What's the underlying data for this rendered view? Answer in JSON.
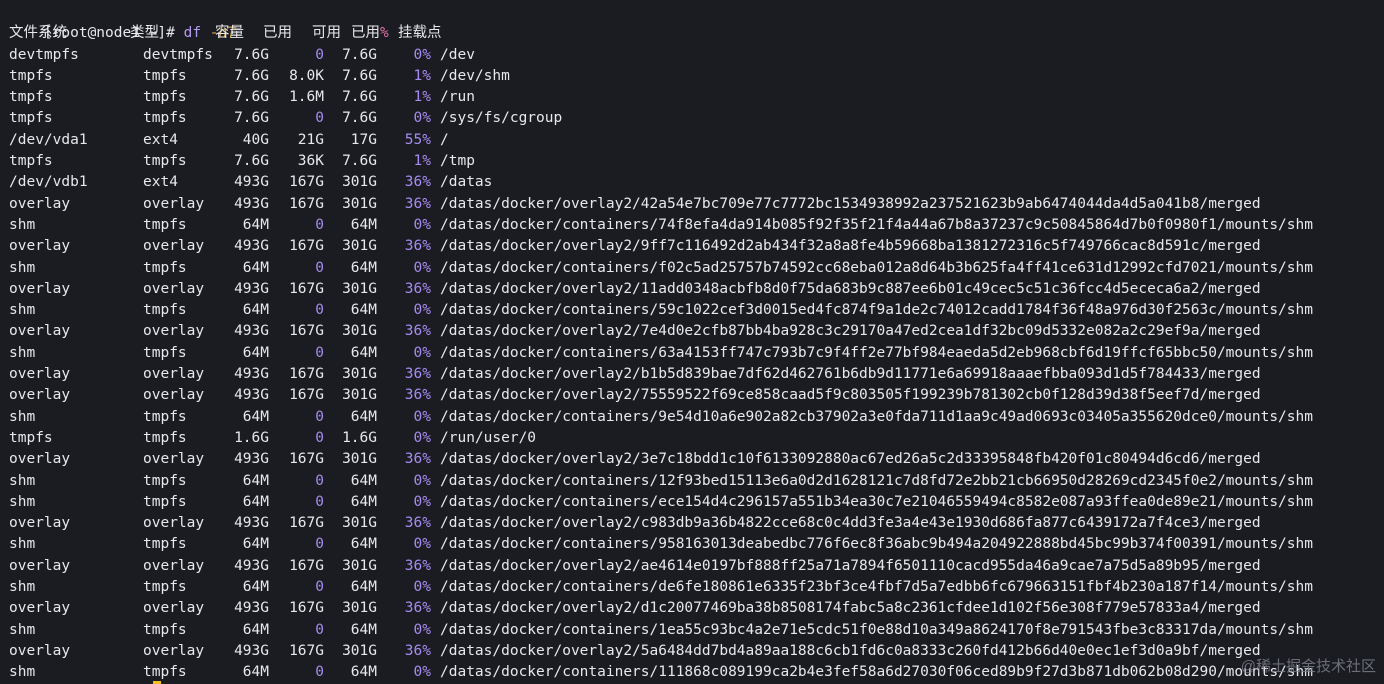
{
  "prompt": {
    "user_host": "[root@node1 ~]#",
    "command": "df",
    "flag": "-hT"
  },
  "header": {
    "filesystem": "文件系统",
    "type": "类型",
    "size": "容量",
    "used": "已用",
    "avail": "可用",
    "pct_label": "已用",
    "pct_sign": "%",
    "mount": "挂载点"
  },
  "rows": [
    {
      "fs": "devtmpfs",
      "type": "devtmpfs",
      "size": "7.6G",
      "used": "0",
      "avail": "7.6G",
      "pct": "0%",
      "mount": "/dev"
    },
    {
      "fs": "tmpfs",
      "type": "tmpfs",
      "size": "7.6G",
      "used": "8.0K",
      "avail": "7.6G",
      "pct": "1%",
      "mount": "/dev/shm"
    },
    {
      "fs": "tmpfs",
      "type": "tmpfs",
      "size": "7.6G",
      "used": "1.6M",
      "avail": "7.6G",
      "pct": "1%",
      "mount": "/run"
    },
    {
      "fs": "tmpfs",
      "type": "tmpfs",
      "size": "7.6G",
      "used": "0",
      "avail": "7.6G",
      "pct": "0%",
      "mount": "/sys/fs/cgroup"
    },
    {
      "fs": "/dev/vda1",
      "type": "ext4",
      "size": "40G",
      "used": "21G",
      "avail": "17G",
      "pct": "55%",
      "mount": "/"
    },
    {
      "fs": "tmpfs",
      "type": "tmpfs",
      "size": "7.6G",
      "used": "36K",
      "avail": "7.6G",
      "pct": "1%",
      "mount": "/tmp"
    },
    {
      "fs": "/dev/vdb1",
      "type": "ext4",
      "size": "493G",
      "used": "167G",
      "avail": "301G",
      "pct": "36%",
      "mount": "/datas"
    },
    {
      "fs": "overlay",
      "type": "overlay",
      "size": "493G",
      "used": "167G",
      "avail": "301G",
      "pct": "36%",
      "mount": "/datas/docker/overlay2/42a54e7bc709e77c7772bc1534938992a237521623b9ab6474044da4d5a041b8/merged"
    },
    {
      "fs": "shm",
      "type": "tmpfs",
      "size": "64M",
      "used": "0",
      "avail": "64M",
      "pct": "0%",
      "mount": "/datas/docker/containers/74f8efa4da914b085f92f35f21f4a44a67b8a37237c9c50845864d7b0f0980f1/mounts/shm"
    },
    {
      "fs": "overlay",
      "type": "overlay",
      "size": "493G",
      "used": "167G",
      "avail": "301G",
      "pct": "36%",
      "mount": "/datas/docker/overlay2/9ff7c116492d2ab434f32a8a8fe4b59668ba1381272316c5f749766cac8d591c/merged"
    },
    {
      "fs": "shm",
      "type": "tmpfs",
      "size": "64M",
      "used": "0",
      "avail": "64M",
      "pct": "0%",
      "mount": "/datas/docker/containers/f02c5ad25757b74592cc68eba012a8d64b3b625fa4ff41ce631d12992cfd7021/mounts/shm"
    },
    {
      "fs": "overlay",
      "type": "overlay",
      "size": "493G",
      "used": "167G",
      "avail": "301G",
      "pct": "36%",
      "mount": "/datas/docker/overlay2/11add0348acbfb8d0f75da683b9c887ee6b01c49cec5c51c36fcc4d5ececa6a2/merged"
    },
    {
      "fs": "shm",
      "type": "tmpfs",
      "size": "64M",
      "used": "0",
      "avail": "64M",
      "pct": "0%",
      "mount": "/datas/docker/containers/59c1022cef3d0015ed4fc874f9a1de2c74012cadd1784f36f48a976d30f2563c/mounts/shm"
    },
    {
      "fs": "overlay",
      "type": "overlay",
      "size": "493G",
      "used": "167G",
      "avail": "301G",
      "pct": "36%",
      "mount": "/datas/docker/overlay2/7e4d0e2cfb87bb4ba928c3c29170a47ed2cea1df32bc09d5332e082a2c29ef9a/merged"
    },
    {
      "fs": "shm",
      "type": "tmpfs",
      "size": "64M",
      "used": "0",
      "avail": "64M",
      "pct": "0%",
      "mount": "/datas/docker/containers/63a4153ff747c793b7c9f4ff2e77bf984eaeda5d2eb968cbf6d19ffcf65bbc50/mounts/shm"
    },
    {
      "fs": "overlay",
      "type": "overlay",
      "size": "493G",
      "used": "167G",
      "avail": "301G",
      "pct": "36%",
      "mount": "/datas/docker/overlay2/b1b5d839bae7df62d462761b6db9d11771e6a69918aaaefbba093d1d5f784433/merged"
    },
    {
      "fs": "overlay",
      "type": "overlay",
      "size": "493G",
      "used": "167G",
      "avail": "301G",
      "pct": "36%",
      "mount": "/datas/docker/overlay2/75559522f69ce858caad5f9c803505f199239b781302cb0f128d39d38f5eef7d/merged"
    },
    {
      "fs": "shm",
      "type": "tmpfs",
      "size": "64M",
      "used": "0",
      "avail": "64M",
      "pct": "0%",
      "mount": "/datas/docker/containers/9e54d10a6e902a82cb37902a3e0fda711d1aa9c49ad0693c03405a355620dce0/mounts/shm"
    },
    {
      "fs": "tmpfs",
      "type": "tmpfs",
      "size": "1.6G",
      "used": "0",
      "avail": "1.6G",
      "pct": "0%",
      "mount": "/run/user/0"
    },
    {
      "fs": "overlay",
      "type": "overlay",
      "size": "493G",
      "used": "167G",
      "avail": "301G",
      "pct": "36%",
      "mount": "/datas/docker/overlay2/3e7c18bdd1c10f6133092880ac67ed26a5c2d33395848fb420f01c80494d6cd6/merged"
    },
    {
      "fs": "shm",
      "type": "tmpfs",
      "size": "64M",
      "used": "0",
      "avail": "64M",
      "pct": "0%",
      "mount": "/datas/docker/containers/12f93bed15113e6a0d2d1628121c7d8fd72e2bb21cb66950d28269cd2345f0e2/mounts/shm"
    },
    {
      "fs": "shm",
      "type": "tmpfs",
      "size": "64M",
      "used": "0",
      "avail": "64M",
      "pct": "0%",
      "mount": "/datas/docker/containers/ece154d4c296157a551b34ea30c7e21046559494c8582e087a93ffea0de89e21/mounts/shm"
    },
    {
      "fs": "overlay",
      "type": "overlay",
      "size": "493G",
      "used": "167G",
      "avail": "301G",
      "pct": "36%",
      "mount": "/datas/docker/overlay2/c983db9a36b4822cce68c0c4dd3fe3a4e43e1930d686fa877c6439172a7f4ce3/merged"
    },
    {
      "fs": "shm",
      "type": "tmpfs",
      "size": "64M",
      "used": "0",
      "avail": "64M",
      "pct": "0%",
      "mount": "/datas/docker/containers/958163013deabedbc776f6ec8f36abc9b494a204922888bd45bc99b374f00391/mounts/shm"
    },
    {
      "fs": "overlay",
      "type": "overlay",
      "size": "493G",
      "used": "167G",
      "avail": "301G",
      "pct": "36%",
      "mount": "/datas/docker/overlay2/ae4614e0197bf888ff25a71a7894f6501110cacd955da46a9cae7a75d5a89b95/merged"
    },
    {
      "fs": "shm",
      "type": "tmpfs",
      "size": "64M",
      "used": "0",
      "avail": "64M",
      "pct": "0%",
      "mount": "/datas/docker/containers/de6fe180861e6335f23bf3ce4fbf7d5a7edbb6fc679663151fbf4b230a187f14/mounts/shm"
    },
    {
      "fs": "overlay",
      "type": "overlay",
      "size": "493G",
      "used": "167G",
      "avail": "301G",
      "pct": "36%",
      "mount": "/datas/docker/overlay2/d1c20077469ba38b8508174fabc5a8c2361cfdee1d102f56e308f779e57833a4/merged"
    },
    {
      "fs": "shm",
      "type": "tmpfs",
      "size": "64M",
      "used": "0",
      "avail": "64M",
      "pct": "0%",
      "mount": "/datas/docker/containers/1ea55c93bc4a2e71e5cdc51f0e88d10a349a8624170f8e791543fbe3c83317da/mounts/shm"
    },
    {
      "fs": "overlay",
      "type": "overlay",
      "size": "493G",
      "used": "167G",
      "avail": "301G",
      "pct": "36%",
      "mount": "/datas/docker/overlay2/5a6484dd7bd4a89aa188c6cb1fd6c0a8333c260fd412b66d40e0ec1ef3d0a9bf/merged"
    },
    {
      "fs": "shm",
      "type": "tmpfs",
      "size": "64M",
      "used": "0",
      "avail": "64M",
      "pct": "0%",
      "mount": "/datas/docker/containers/111868c089199ca2b4e3fef58a6d27030f06ced89b9f27d3b871db062b08d290/mounts/shm"
    }
  ],
  "watermark": "@稀土掘金技术社区",
  "colors": {
    "background": "#1b1c22",
    "foreground": "#e8e8ea",
    "accent_purple": "#a78bf0",
    "percent_pink": "#e070a8",
    "flag_yellow": "#d6a44a",
    "cursor": "#f0c020"
  }
}
